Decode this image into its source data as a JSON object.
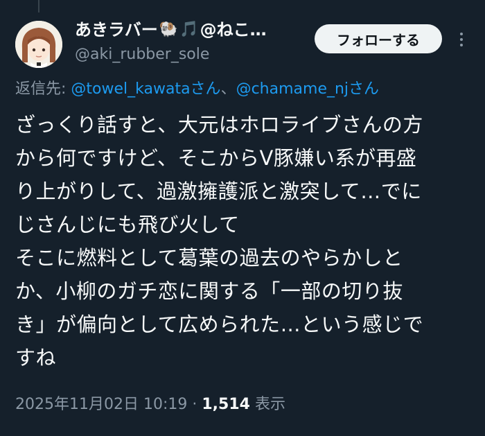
{
  "author": {
    "display_name": "あきラバー",
    "name_suffix": "@ねこ…",
    "emoji_1": "🐏",
    "emoji_2": "🎵",
    "handle": "@aki_rubber_sole"
  },
  "follow_label": "フォローする",
  "reply": {
    "prefix": "返信先: ",
    "mention_1": "@towel_kawataさん",
    "separator": "、",
    "mention_2": "@chamame_njさん"
  },
  "tweet_lines": [
    "ざっくり話すと、大元はホロライブさんの方",
    "から何ですけど、そこからV豚嫌い系が再盛",
    "り上がりして、過激擁護派と激突して…でに",
    "じさんじにも飛び火して",
    "そこに燃料として葛葉の過去のやらかしと",
    "か、小柳のガチ恋に関する「一部の切り抜",
    "き」が偏向として広められた…という感じで",
    "すね"
  ],
  "meta": {
    "timestamp": "2025年11月02日 10:19",
    "dot": " · ",
    "views_count": "1,514",
    "views_label": " 表示"
  },
  "icons": [
    "avatar",
    "more-icon"
  ]
}
